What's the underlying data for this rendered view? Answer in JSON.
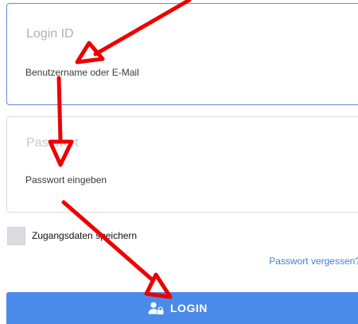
{
  "login_id": {
    "label": "Login ID",
    "placeholder": "Benutzername oder E-Mail"
  },
  "password": {
    "label": "Passwort",
    "placeholder": "Passwort eingeben"
  },
  "remember": {
    "label": "Zugangsdaten speichern",
    "checked": false
  },
  "forgot_link": "Passwort vergessen?",
  "login_button": {
    "label": "LOGIN",
    "icon": "user-lock-icon"
  },
  "annotation": {
    "color": "#ee0000"
  },
  "colors": {
    "accent": "#4a8bea",
    "active_border": "#6f93e0",
    "link": "#3f7fd6"
  }
}
